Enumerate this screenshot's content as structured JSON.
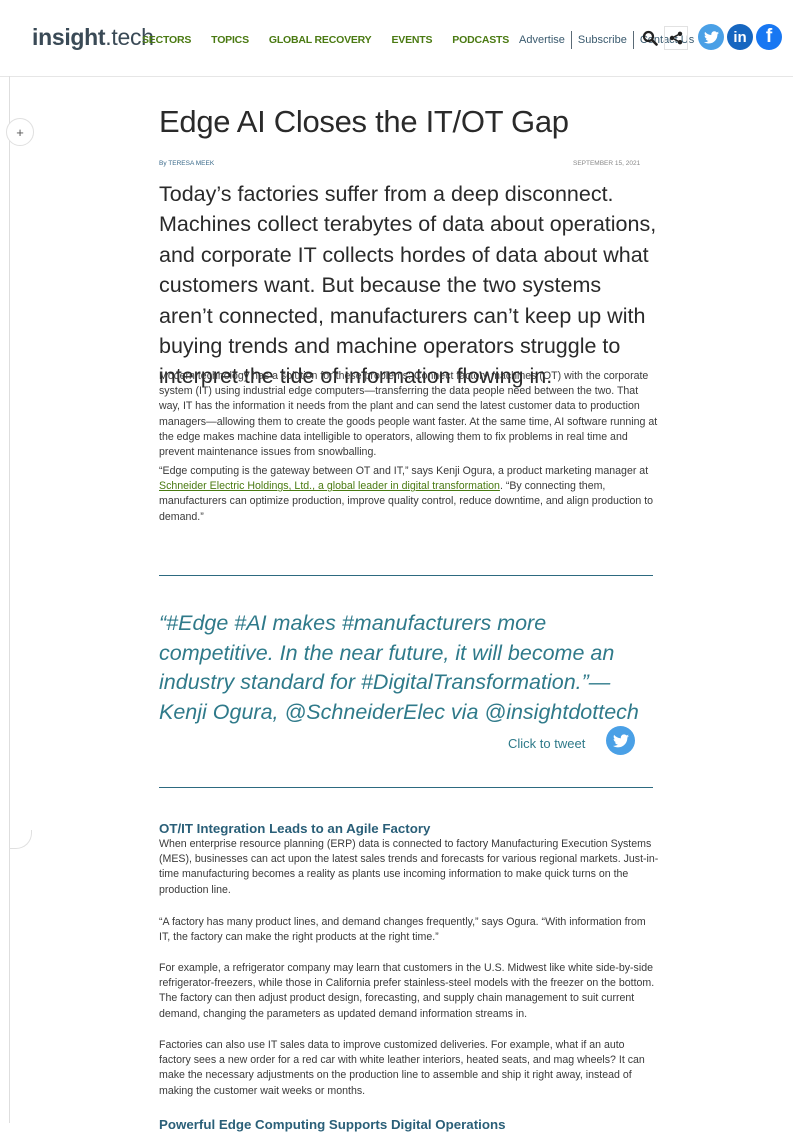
{
  "header": {
    "logo_bold": "insight",
    "logo_light": ".tech",
    "sections": [
      "SECTORS",
      "TOPICS",
      "GLOBAL RECOVERY",
      "EVENTS",
      "PODCASTS"
    ],
    "utility_links": [
      "Advertise",
      "Subscribe",
      "Contact Us"
    ],
    "icons": [
      "search-icon",
      "share-icon",
      "twitter-icon",
      "linkedin-icon",
      "facebook-icon"
    ],
    "linkedin_glyph": "in",
    "facebook_glyph": "f"
  },
  "sidebar": {
    "expand_glyph": "+"
  },
  "article": {
    "title": "Edge AI Closes the IT/OT Gap",
    "byline": "By TERESA MEEK",
    "date": "SEPTEMBER 15, 2021",
    "lead": "Today’s factories suffer from a deep disconnect. Machines collect terabytes of data about operations, and corporate IT collects hordes of data about what customers want. But because the two systems aren’t connected, manufacturers can’t keep up with buying trends and machine operators struggle to interpret the tide of information flowing in.",
    "p1": "Modern technology has a solution for these problems: Connect factory machines (OT) with the corporate system (IT) using industrial edge computers—transferring the data people need between the two. That way, IT has the information it needs from the plant and can send the latest customer data to production managers—allowing them to create the goods people want faster. At the same time, AI software running at the edge makes machine data intelligible to operators, allowing them to fix problems in real time and prevent maintenance issues from snowballing.",
    "p2_before": "“Edge computing is the gateway between OT and IT,” says Kenji Ogura, a product marketing manager at ",
    "p2_link": "Schneider Electric Holdings, Ltd., a global leader in digital transformation",
    "p2_after": ". “By connecting them, manufacturers can optimize production, improve quality control, reduce downtime, and align production to demand.”",
    "quote": "“#Edge #AI makes #manufacturers more competitive. In the near future, it will become an industry standard for #DigitalTransformation.”—Kenji Ogura, @SchneiderElec via @insightdottech",
    "click_to_tweet": "Click to tweet",
    "h2": "OT/IT Integration Leads to an Agile Factory",
    "p3": "When enterprise resource planning (ERP) data is connected to factory Manufacturing Execution Systems (MES), businesses can act upon the latest sales trends and forecasts for various regional markets. Just-in-time manufacturing becomes a reality as plants use incoming information to make quick turns on the production line.",
    "p4": "“A factory has many product lines, and demand changes frequently,” says Ogura. “With information from IT, the factory can make the right products at the right time.”",
    "p5": "For example, a refrigerator company may learn that customers in the U.S. Midwest like white side-by-side refrigerator-freezers, while those in California prefer stainless-steel models with the freezer on the bottom. The factory can then adjust product design, forecasting, and supply chain management to suit current demand, changing the parameters as updated demand information streams in.",
    "p6": "Factories can also use IT sales data to improve customized deliveries. For example, what if an auto factory sees a new order for a red car with white leather interiors, heated seats, and mag wheels? It can make the necessary adjustments on the production line to assemble and ship it right away, instead of making the customer wait weeks or months.",
    "h2_next": "Powerful Edge Computing Supports Digital Operations"
  }
}
